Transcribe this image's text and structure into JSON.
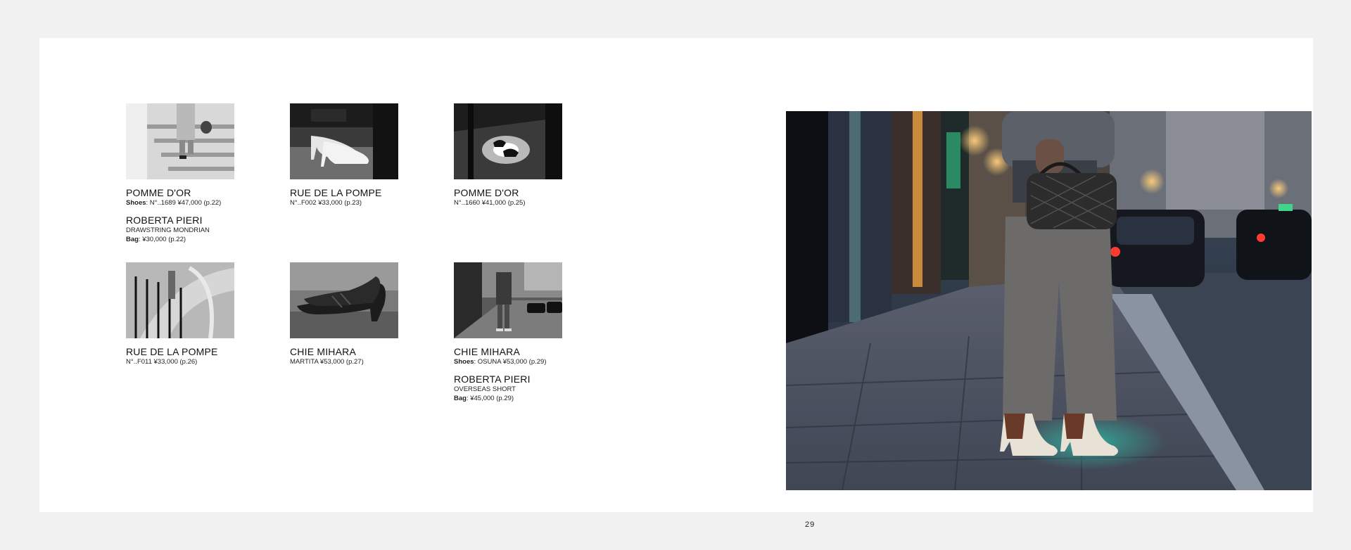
{
  "page_number": "29",
  "items": [
    {
      "lines": [
        {
          "brand": "POMME D'OR"
        },
        {
          "label": "Shoes",
          "text": ": N°..1689  ¥47,000 (p.22)"
        },
        {
          "brand": "ROBERTA PIERI"
        },
        {
          "text": "DRAWSTRING MONDRIAN"
        },
        {
          "label": "Bag",
          "text": ": ¥30,000 (p.22)"
        }
      ]
    },
    {
      "lines": [
        {
          "brand": "RUE DE LA POMPE"
        },
        {
          "text": "N°..F002  ¥33,000 (p.23)"
        }
      ]
    },
    {
      "lines": [
        {
          "brand": "POMME D'OR"
        },
        {
          "text": "N°..1660  ¥41,000 (p.25)"
        }
      ]
    },
    {
      "lines": [
        {
          "brand": "RUE DE LA POMPE"
        },
        {
          "text": "N°..F011  ¥33,000 (p.26)"
        }
      ]
    },
    {
      "lines": [
        {
          "brand": "CHIE MIHARA"
        },
        {
          "text": "MARTITA  ¥53,000 (p.27)"
        }
      ]
    },
    {
      "lines": [
        {
          "brand": "CHIE MIHARA"
        },
        {
          "label": "Shoes",
          "text": ": OSUNA  ¥53,000 (p.29)"
        },
        {
          "brand": "ROBERTA PIERI"
        },
        {
          "text": "OVERSEAS SHORT"
        },
        {
          "label": "Bag",
          "text": ": ¥45,000 (p.29)"
        }
      ]
    }
  ]
}
